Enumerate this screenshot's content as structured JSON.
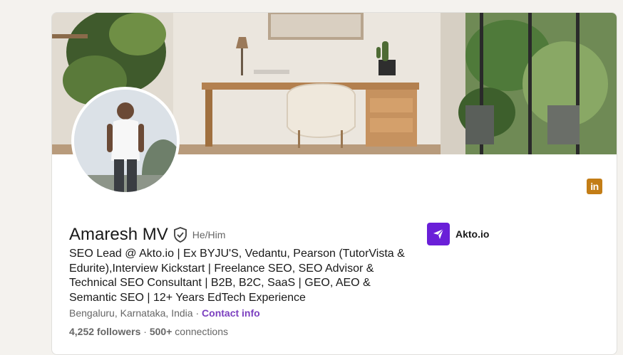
{
  "profile": {
    "name": "Amaresh MV",
    "pronouns": "He/Him",
    "headline": "SEO Lead @ Akto.io | Ex BYJU'S, Vedantu, Pearson (TutorVista & Edurite),Interview Kickstart | Freelance SEO, SEO Advisor & Technical SEO Consultant | B2B, B2C, SaaS | GEO, AEO & Semantic SEO | 12+ Years EdTech Experience",
    "location": "Bengaluru, Karnataka, India",
    "separator": " · ",
    "contact_info": "Contact info",
    "followers_count": "4,252 followers",
    "stats_separator": " · ",
    "connections_count": "500+",
    "connections_label": " connections"
  },
  "company": {
    "name": "Akto.io"
  },
  "linkedin_badge": {
    "label": "in"
  },
  "icons": {
    "verified": "verified-shield-icon",
    "company_logo": "send-arrow-icon",
    "linkedin": "linkedin-icon"
  },
  "colors": {
    "accent": "#7b3fbf",
    "company_logo_bg": "#6a1fd8",
    "linkedin_badge_bg": "#c37d16"
  }
}
